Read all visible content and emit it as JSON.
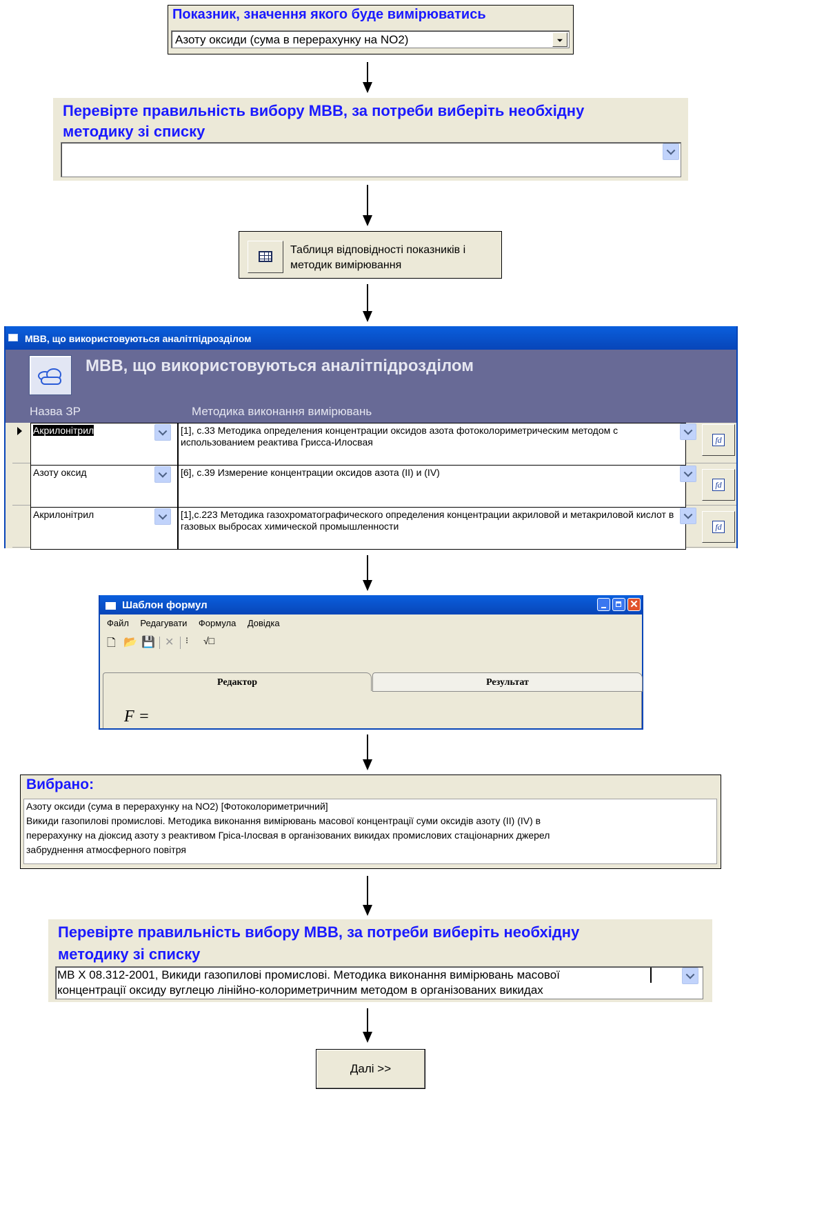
{
  "indicator": {
    "title": "Показник, значення якого буде вимірюватись",
    "selected": "Азоту оксиди (сума в перерахунку на NO2)"
  },
  "check_method_1": {
    "title_line1": "Перевірте правильність вибору МВВ, за потреби виберіть необхідну",
    "title_line2": "методику зі списку",
    "value": ""
  },
  "table_button": {
    "line1": "Таблиця відповідності показників і",
    "line2": "методик вимірювання"
  },
  "mvb_window": {
    "title": "МВВ, що використовуються аналітпідрозділом",
    "header": "МВВ, що використовуються аналітпідрозділом",
    "col_name": "Назва ЗР",
    "col_method": "Методика виконання вимірювань",
    "rows": [
      {
        "name": "Акрилонітрил",
        "method": "[1], с.33   Методика определения концентрации оксидов азота фотоколориметрическим методом с использованием реактива Грисса-Илосвая"
      },
      {
        "name": "Азоту оксид",
        "method": "[6], с.39   Измерение концентрации оксидов азота (II) и (IV)"
      },
      {
        "name": "Акрилонітрил",
        "method": "[1],с.223   Методика газохроматографического определения концентрации акриловой и метакриловой кислот в газовых выбросах химической промышленности"
      }
    ]
  },
  "formula_window": {
    "title": "Шаблон формул",
    "menu": [
      "Файл",
      "Редагувати",
      "Формула",
      "Довідка"
    ],
    "tab_editor": "Редактор",
    "tab_result": "Результат",
    "formula": "F ="
  },
  "selected_box": {
    "title": "Вибрано:",
    "line1": "Азоту оксиди (сума в перерахунку на NO2) [Фотоколориметричний]",
    "line2": "Викиди газопилові промислові. Методика виконання вимірювань масової концентрації суми оксидів азоту (II) (IV) в",
    "line3": "перерахунку на діоксид азоту з реактивом Гріса-Ілосвая в організованих викидах промислових стаціонарних джерел",
    "line4": "забруднення атмосферного повітря"
  },
  "check_method_2": {
    "title_line1": "Перевірте правильність вибору МВВ, за потреби виберіть необхідну",
    "title_line2": "методику зі списку",
    "value_line1": "МВ Х 08.312-2001, Викиди газопилові промислові. Методика виконання вимірювань масової",
    "value_line2": "концентрації оксиду вуглецю лінійно-колориметричним методом в організованих викидах"
  },
  "next_button": {
    "label": "Далі >>"
  }
}
